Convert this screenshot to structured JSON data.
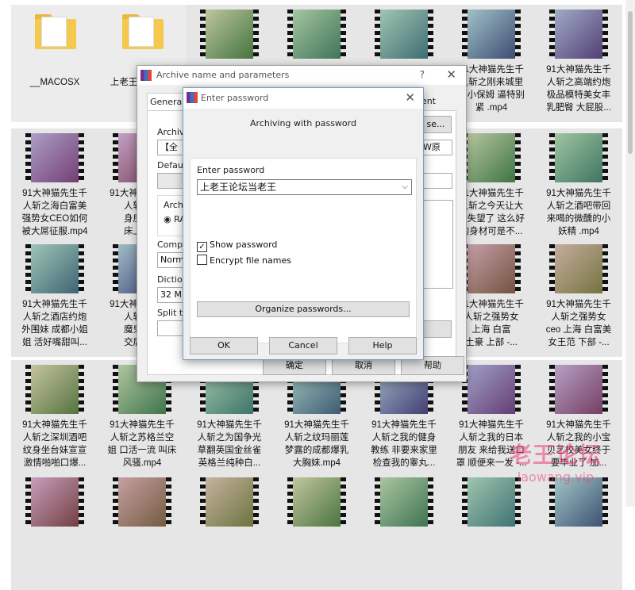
{
  "explorer": {
    "tiles": [
      {
        "label": "__MACOSX",
        "folder": true
      },
      {
        "label": "上老王论坛当老\n王",
        "folder": true
      },
      {
        "label": ""
      },
      {
        "label": ""
      },
      {
        "label": ""
      },
      {
        "label": "91大神猫先生千\n人斩之刚来城里\n的小保姆 逼特别\n紧 .mp4"
      },
      {
        "label": "91大神猫先生千\n人斩之高端约炮\n极品模特美女丰\n乳肥臀 大屁股..."
      },
      {
        "label": "91大神猫先生千\n人斩之海白富美\n强势女CEO如何\n被大屌征服.mp4"
      },
      {
        "label": "91大神猫先生千\n人斩之和\n身房的小\n床上做有"
      },
      {
        "label": ""
      },
      {
        "label": ""
      },
      {
        "label": ""
      },
      {
        "label": "91大神猫先生千\n人斩之今天让大\n家失望了 这么好\n的身材可是不..."
      },
      {
        "label": "91大神猫先生千\n人斩之酒吧带回\n来喝的微醺的小\n妖精 .mp4"
      },
      {
        "label": "91大神猫先生千\n人斩之酒店约炮\n外围妹 成都小姐\n姐 活好嘴甜叫..."
      },
      {
        "label": "91大神猫先生千\n人斩之两\n魔鬼身材\n交后入咧"
      },
      {
        "label": ""
      },
      {
        "label": ""
      },
      {
        "label": ""
      },
      {
        "label": "91大神猫先生千\n人斩之强势女\n上海 白富\n土豪 上部 -..."
      },
      {
        "label": "91大神猫先生千\n人斩之强势女\nceo 上海 白富美\n女王范 下部 -..."
      },
      {
        "label": "91大神猫先生千\n人斩之深圳酒吧\n纹身坐台妹宣宣\n激情啪啪口爆..."
      },
      {
        "label": "91大神猫先生千\n人斩之苏格兰空\n姐 口活一流 叫床\n风骚.mp4"
      },
      {
        "label": "91大神猫先生千\n人斩之为国争光\n草翻英国金丝雀\n英格兰纯种白..."
      },
      {
        "label": "91大神猫先生千\n人斩之纹玛丽莲\n梦露的成都爆乳\n大胸妹.mp4"
      },
      {
        "label": "91大神猫先生千\n人斩之我的健身\n教练 非要来家里\n检查我的睾丸..."
      },
      {
        "label": "91大神猫先生千\n人斩之我的日本\n朋友 来给我送口\n罩 顺便来一发 -..."
      },
      {
        "label": "91大神猫先生千\n人斩之我的小宝\n贝艺校美女终于\n要毕业了 加..."
      },
      {
        "label": ""
      },
      {
        "label": ""
      },
      {
        "label": ""
      },
      {
        "label": ""
      },
      {
        "label": ""
      },
      {
        "label": ""
      },
      {
        "label": ""
      }
    ]
  },
  "watermark": {
    "text": "老王论坛",
    "url": "laowang.vip",
    "color": "#ec407a"
  },
  "archive_dialog": {
    "title": "Archive name and parameters",
    "help_glyph": "?",
    "close_glyph": "✕",
    "tab_general": "General",
    "tab_right": "ent",
    "archive_label": "Archive",
    "archive_value": "【全",
    "browse_label": "se...",
    "profile_value": "W原",
    "default_label": "Default",
    "archive_format_label": "Archiv",
    "rar_label": "RA",
    "compression_label": "Compre",
    "compression_value": "Norma",
    "dictionary_label": "Dictiona",
    "dictionary_value": "32 MB",
    "split_label": "Split to",
    "ok_label": "确定",
    "cancel_label": "取消",
    "help_label": "帮助"
  },
  "password_dialog": {
    "title": "Enter password",
    "close_glyph": "✕",
    "heading": "Archiving with password",
    "enter_password_label": "Enter password",
    "password_value": "上老王论坛当老王",
    "dropdown_glyph": "⌵",
    "show_password_label": "Show password",
    "show_password_checked": true,
    "check_glyph": "✓",
    "encrypt_names_label": "Encrypt file names",
    "encrypt_names_checked": false,
    "organize_label": "Organize passwords...",
    "ok_label": "OK",
    "cancel_label": "Cancel",
    "help_label": "Help"
  }
}
